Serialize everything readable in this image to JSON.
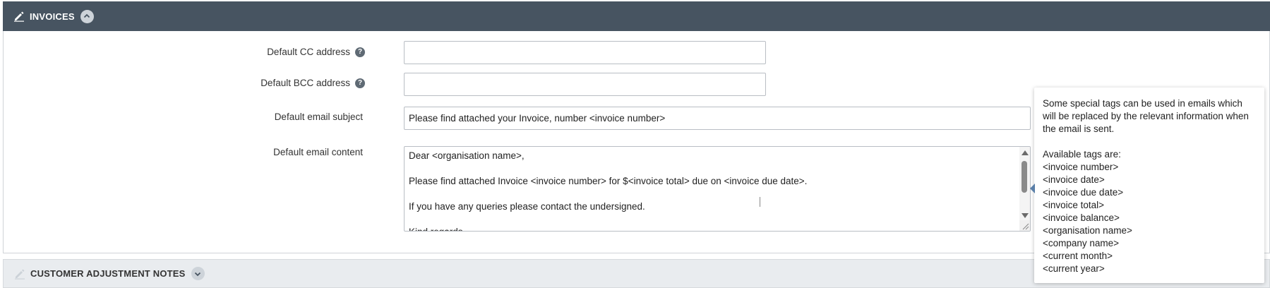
{
  "invoices_panel": {
    "title": "INVOICES",
    "icon": "pencil-icon",
    "toggle": "chevron-up-icon"
  },
  "form": {
    "cc": {
      "label": "Default CC address",
      "value": "",
      "help_icon": "question-circle-icon"
    },
    "bcc": {
      "label": "Default BCC address",
      "value": "",
      "help_icon": "question-circle-icon"
    },
    "subject": {
      "label": "Default email subject",
      "value": "Please find attached your Invoice, number <invoice number>"
    },
    "content": {
      "label": "Default email content",
      "value": "Dear <organisation name>,\n\nPlease find attached Invoice <invoice number> for $<invoice total> due on <invoice due date>.\n\nIf you have any queries please contact the undersigned.\n\nKind regards"
    }
  },
  "tooltip": {
    "intro": "Some special tags can be used in emails which will be replaced by the relevant information when the email is sent.",
    "tags_heading": "Available tags are:",
    "tags": [
      "<invoice number>",
      "<invoice date>",
      "<invoice due date>",
      "<invoice total>",
      "<invoice balance>",
      "<organisation name>",
      "<company name>",
      "<current month>",
      "<current year>"
    ]
  },
  "adjustment_panel": {
    "title": "CUSTOMER ADJUSTMENT NOTES",
    "icon": "pencil-icon",
    "toggle": "chevron-down-icon"
  },
  "colors": {
    "header_bg": "#475461",
    "collapsed_header_bg": "#e9ecef",
    "tooltip_arrow": "#5a7fa8"
  }
}
